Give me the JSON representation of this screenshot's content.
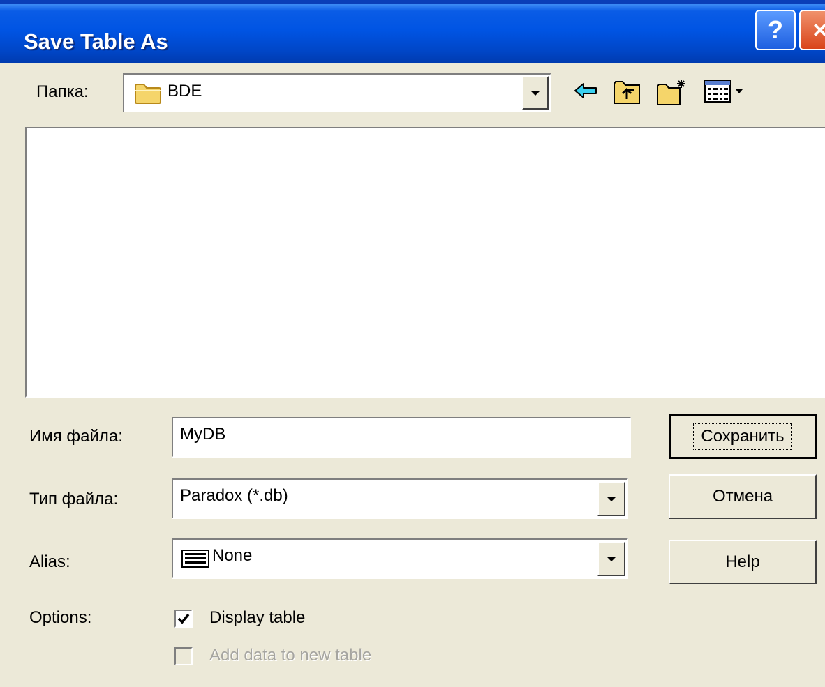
{
  "window": {
    "title": "Save Table As",
    "help_label": "?",
    "close_label": "×"
  },
  "folder_row": {
    "label": "Папка:",
    "current_folder": "BDE",
    "toolbar_icons": [
      "back-arrow-icon",
      "up-folder-icon",
      "new-folder-icon",
      "view-menu-icon"
    ]
  },
  "file_list": {
    "items": []
  },
  "fields": {
    "file_name_label": "Имя файла:",
    "file_name_value": "MyDB",
    "file_type_label": "Тип файла:",
    "file_type_value": "Paradox (*.db)",
    "alias_label": "Alias:",
    "alias_value": "None",
    "options_label": "Options:"
  },
  "buttons": {
    "save": "Сохранить",
    "cancel": "Отмена",
    "help": "Help"
  },
  "options": {
    "display_table_label": "Display table",
    "display_table_checked": true,
    "add_data_label": "Add data to new table",
    "add_data_checked": false,
    "add_data_enabled": false
  },
  "colors": {
    "titlebar": "#0054e3",
    "dialog_bg": "#ece9d8",
    "close_button": "#d9441a"
  }
}
